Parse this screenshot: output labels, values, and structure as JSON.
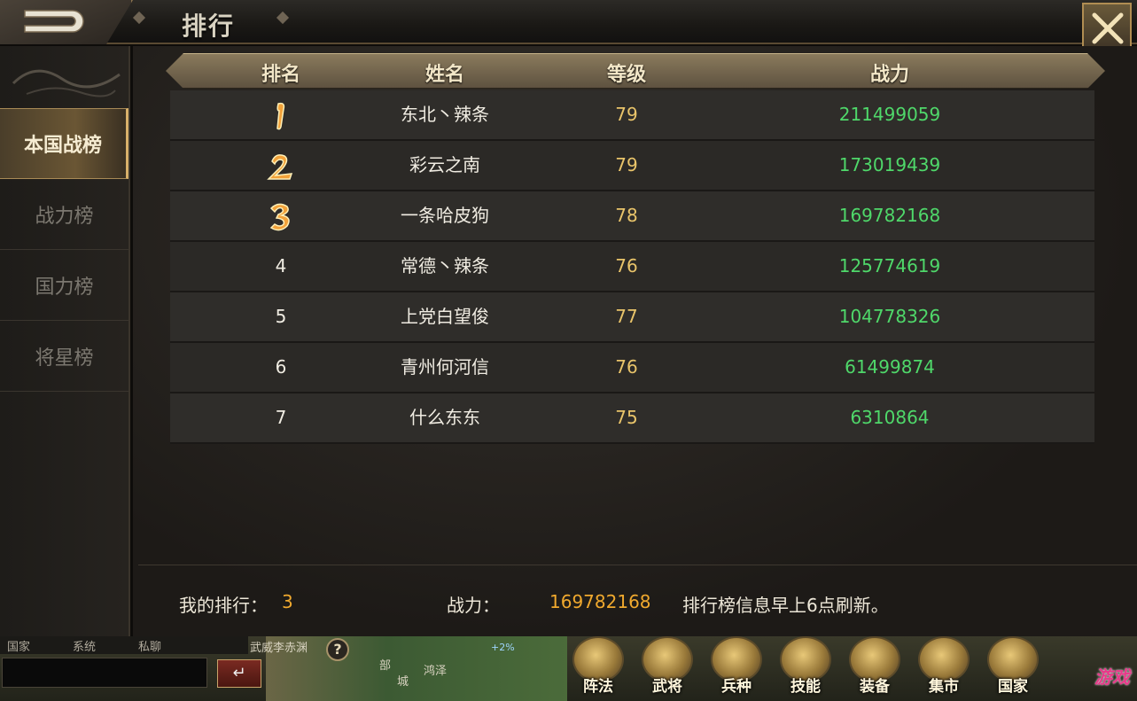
{
  "header": {
    "title": "排行"
  },
  "sidebar": {
    "items": [
      {
        "label": "本国战榜",
        "active": true
      },
      {
        "label": "战力榜",
        "active": false
      },
      {
        "label": "国力榜",
        "active": false
      },
      {
        "label": "将星榜",
        "active": false
      }
    ]
  },
  "table": {
    "columns": [
      "排名",
      "姓名",
      "等级",
      "战力"
    ],
    "rows": [
      {
        "rank": "1",
        "name": "东北丶辣条",
        "level": "79",
        "power": "211499059"
      },
      {
        "rank": "2",
        "name": "彩云之南",
        "level": "79",
        "power": "173019439"
      },
      {
        "rank": "3",
        "name": "一条哈皮狗",
        "level": "78",
        "power": "169782168"
      },
      {
        "rank": "4",
        "name": "常德丶辣条",
        "level": "76",
        "power": "125774619"
      },
      {
        "rank": "5",
        "name": "上党白望俊",
        "level": "77",
        "power": "104778326"
      },
      {
        "rank": "6",
        "name": "青州何河信",
        "level": "76",
        "power": "61499874"
      },
      {
        "rank": "7",
        "name": "什么东东",
        "level": "75",
        "power": "6310864"
      }
    ]
  },
  "footer": {
    "my_rank_label": "我的排行：",
    "my_rank_value": "3",
    "power_label": "战力：",
    "power_value": "169782168",
    "refresh_note": "排行榜信息早上6点刷新。"
  },
  "gamebar": {
    "chat_tabs": [
      "国家",
      "系统",
      "私聊"
    ],
    "scene_texts": [
      "武威李赤渊",
      "+2%",
      "部",
      "城",
      "鸿泽"
    ],
    "help": "?",
    "menu": [
      "阵法",
      "武将",
      "兵种",
      "技能",
      "装备",
      "集市",
      "国家"
    ],
    "watermark": "游戏"
  },
  "colors": {
    "power_green": "#4fd86a",
    "level_gold": "#e9c46a",
    "highlight_orange": "#f0a92e"
  },
  "icons": {
    "back": "back-arrow-icon",
    "close": "close-x-icon",
    "rank_1": "rank-gold-1-icon",
    "rank_2": "rank-gold-2-icon",
    "rank_3": "rank-gold-3-icon"
  }
}
